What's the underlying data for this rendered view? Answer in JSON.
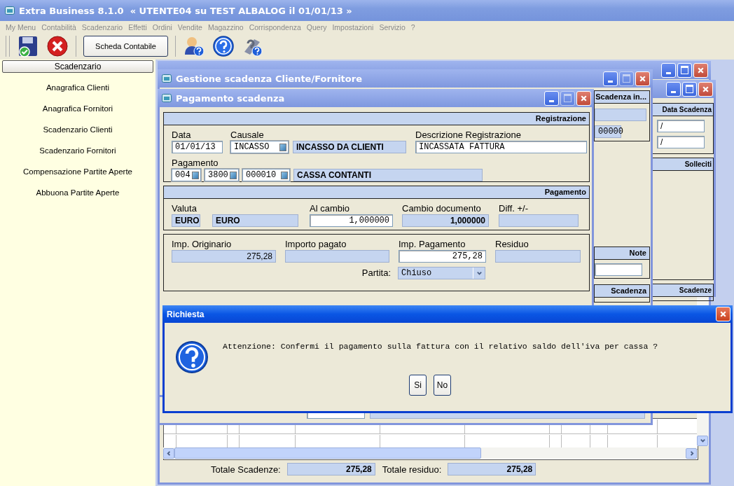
{
  "app": {
    "title": "Extra Business 8.1.0  « UTENTE04 su TEST ALBALOG il 01/01/13 »"
  },
  "menu": [
    "My Menu",
    "Contabilità",
    "Scadenzario",
    "Effetti",
    "Ordini",
    "Vendite",
    "Magazzino",
    "Corrispondenza",
    "Query",
    "Impostazioni",
    "Servizio",
    "?"
  ],
  "toolbar": {
    "button": "Scheda Contabile"
  },
  "sidebar": {
    "header": "Scadenzario",
    "items": [
      "Anagrafica Clienti",
      "Anagrafica Fornitori",
      "Scadenzario Clienti",
      "Scadenzario Fornitori",
      "Compensazione Partite Aperte",
      "Abbuona Partite Aperte"
    ]
  },
  "scadenze_window": {
    "maximize_disabled": false,
    "totals": [
      {
        "label": "Totale Scadenze:",
        "value": "275,28"
      },
      {
        "label": "Totale residuo:",
        "value": "275,28"
      }
    ]
  },
  "detail_window": {
    "maximize_disabled": false,
    "panels": [
      "Data Scadenza",
      "Solleciti",
      "Scadenze"
    ],
    "date_values": [
      "/",
      "/"
    ]
  },
  "gestione_window": {
    "title": "Gestione scadenza Cliente/Fornitore",
    "maximize_disabled": true,
    "panels": [
      "Scadenza in...",
      "Note",
      "Scadenza"
    ],
    "code_value": "00000"
  },
  "pagamento_window": {
    "title": "Pagamento scadenza",
    "maximize_disabled": true,
    "registrazione": {
      "title": "Registrazione",
      "data_label": "Data",
      "data": "01/01/13",
      "causale_label": "Causale",
      "causale": "INCASSO",
      "causale_desc": "INCASSO DA CLIENTI",
      "descr_label": "Descrizione Registrazione",
      "descr": "INCASSATA FATTURA",
      "pagamento_label": "Pagamento",
      "pag_codes": [
        "004",
        "3800",
        "000010"
      ],
      "pag_desc": "CASSA CONTANTI"
    },
    "pagamento": {
      "title": "Pagamento",
      "valuta_label": "Valuta",
      "valuta_code": "EURO",
      "valuta_desc": "EURO",
      "cambio_label": "Al cambio",
      "cambio": "1,000000",
      "doc_label": "Cambio documento",
      "doc": "1,000000",
      "diff_label": "Diff. +/-"
    },
    "importi": {
      "orig_label": "Imp. Originario",
      "orig": "275,28",
      "pagato_label": "Importo pagato",
      "imp_label": "Imp. Pagamento",
      "imp": "275,28",
      "residuo_label": "Residuo",
      "partita_label": "Partita:",
      "partita": "Chiuso"
    }
  },
  "dialog": {
    "title": "Richiesta",
    "message": "Attenzione: Confermi il pagamento sulla fattura con il relativo saldo dell'iva per cassa ?",
    "buttons": [
      "Si",
      "No"
    ]
  }
}
